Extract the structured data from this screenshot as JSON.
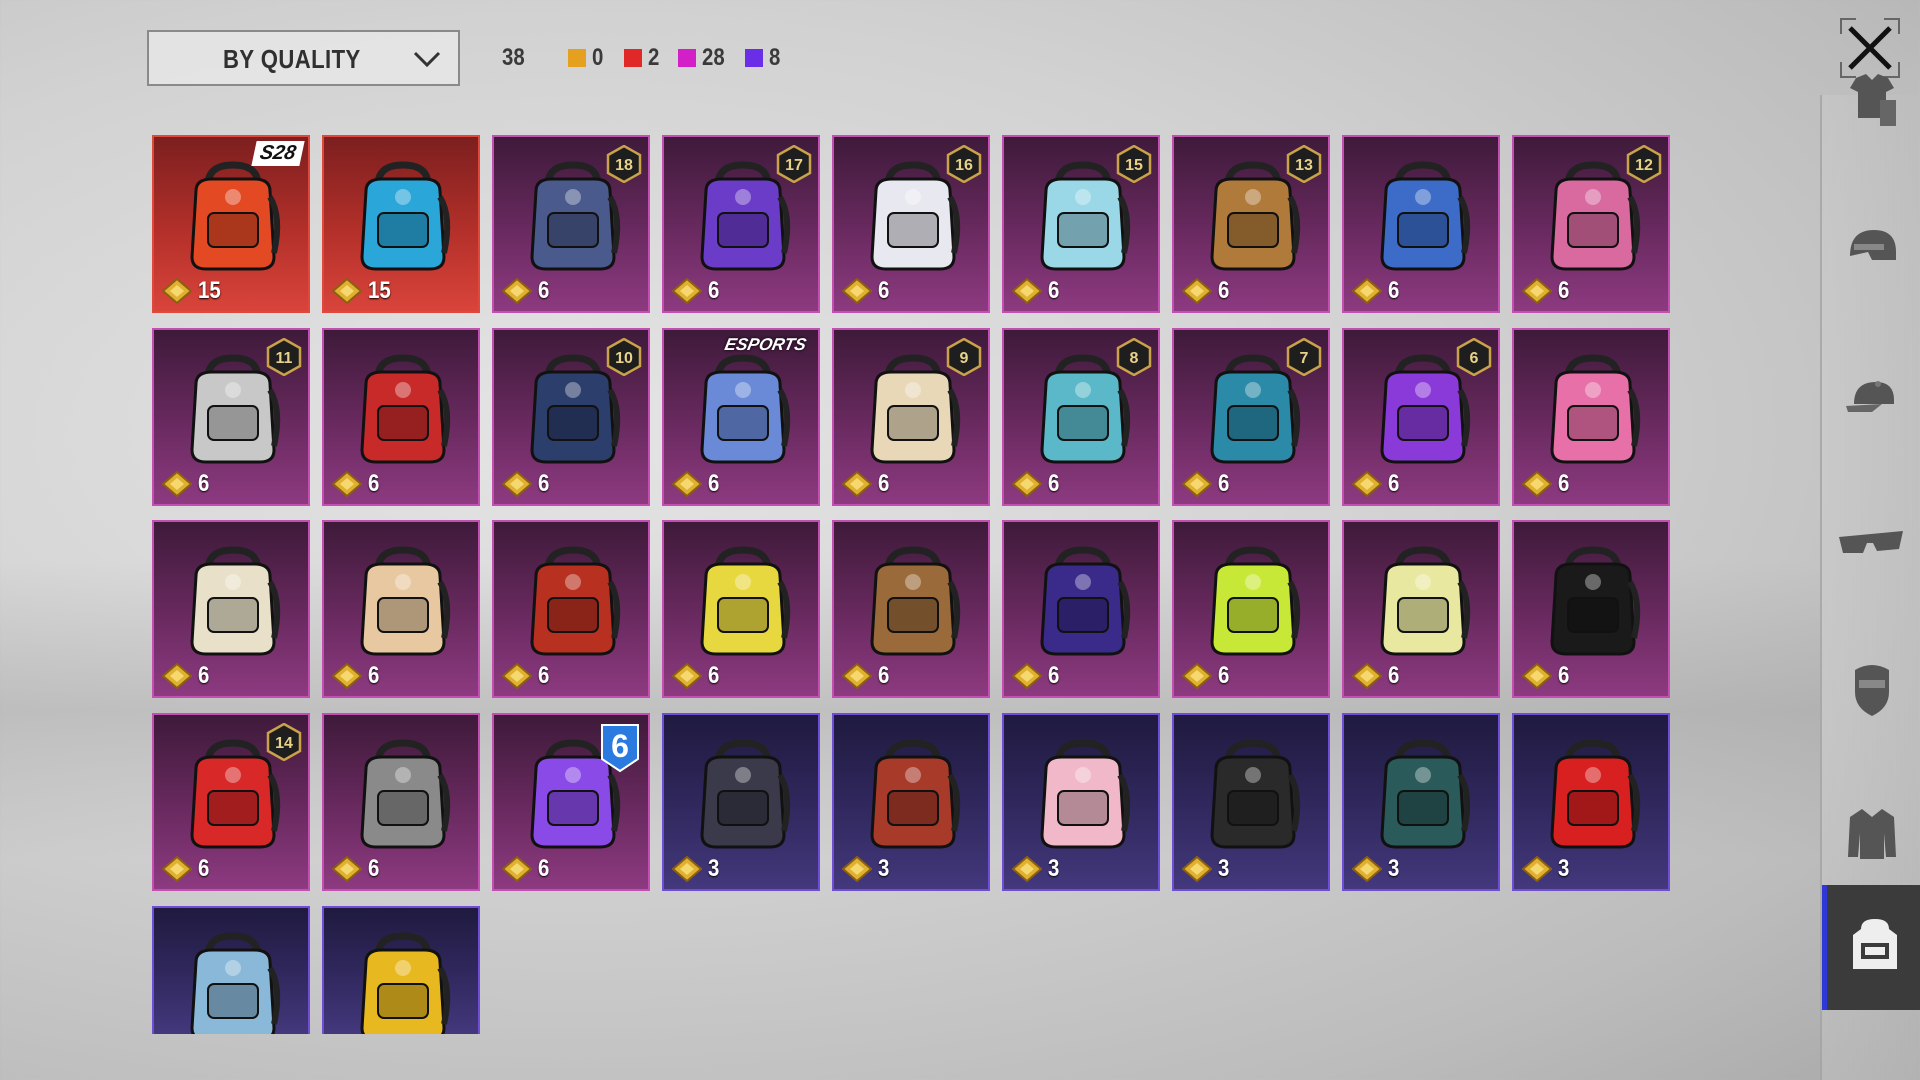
{
  "sort": {
    "label": "BY QUALITY"
  },
  "summary": {
    "total": "38",
    "counts": [
      {
        "color": "#e6a020",
        "value": "0"
      },
      {
        "color": "#e02828",
        "value": "2"
      },
      {
        "color": "#d21fc7",
        "value": "28"
      },
      {
        "color": "#6a2ee6",
        "value": "8"
      }
    ]
  },
  "sidebar": {
    "items": [
      {
        "icon": "outfit-icon",
        "active": false
      },
      {
        "icon": "helmet-icon",
        "active": false
      },
      {
        "icon": "cap-icon",
        "active": false
      },
      {
        "icon": "glasses-icon",
        "active": false
      },
      {
        "icon": "mask-icon",
        "active": false
      },
      {
        "icon": "jacket-icon",
        "active": false
      },
      {
        "icon": "backpack-icon",
        "active": true
      }
    ]
  },
  "items": [
    {
      "quality": "red",
      "price": "15",
      "tag": "S28",
      "color": "#e34a24"
    },
    {
      "quality": "red",
      "price": "15",
      "color": "#2aa6d8"
    },
    {
      "quality": "pink",
      "price": "6",
      "level": "18",
      "color": "#4a5a8c"
    },
    {
      "quality": "pink",
      "price": "6",
      "level": "17",
      "color": "#6b3cc8"
    },
    {
      "quality": "pink",
      "price": "6",
      "level": "16",
      "color": "#e8e8f0"
    },
    {
      "quality": "pink",
      "price": "6",
      "level": "15",
      "color": "#9ad8e8"
    },
    {
      "quality": "pink",
      "price": "6",
      "level": "13",
      "color": "#b07a3a"
    },
    {
      "quality": "pink",
      "price": "6",
      "color": "#3c6cc8"
    },
    {
      "quality": "pink",
      "price": "6",
      "level": "12",
      "color": "#d86aa0"
    },
    {
      "quality": "pink",
      "price": "6",
      "level": "11",
      "color": "#c8c8c8"
    },
    {
      "quality": "pink",
      "price": "6",
      "color": "#c82a2a"
    },
    {
      "quality": "pink",
      "price": "6",
      "level": "10",
      "color": "#2c3e6c"
    },
    {
      "quality": "pink",
      "price": "6",
      "tag": "ESPORTS",
      "color": "#6a8ad8"
    },
    {
      "quality": "pink",
      "price": "6",
      "level": "9",
      "color": "#e8d8b8"
    },
    {
      "quality": "pink",
      "price": "6",
      "level": "8",
      "color": "#5ab8c8"
    },
    {
      "quality": "pink",
      "price": "6",
      "level": "7",
      "color": "#2a8aa8"
    },
    {
      "quality": "pink",
      "price": "6",
      "level": "6",
      "color": "#8a3ad8"
    },
    {
      "quality": "pink",
      "price": "6",
      "color": "#e870a8"
    },
    {
      "quality": "pink",
      "price": "6",
      "color": "#e8e0c8"
    },
    {
      "quality": "pink",
      "price": "6",
      "color": "#e8c8a0"
    },
    {
      "quality": "pink",
      "price": "6",
      "color": "#b83020"
    },
    {
      "quality": "pink",
      "price": "6",
      "color": "#e8d840"
    },
    {
      "quality": "pink",
      "price": "6",
      "color": "#9a6a3a"
    },
    {
      "quality": "pink",
      "price": "6",
      "color": "#3a2a8a"
    },
    {
      "quality": "pink",
      "price": "6",
      "color": "#c8e838"
    },
    {
      "quality": "pink",
      "price": "6",
      "color": "#e8e8a0"
    },
    {
      "quality": "pink",
      "price": "6",
      "color": "#1a1a1a"
    },
    {
      "quality": "pink",
      "price": "6",
      "level": "14",
      "color": "#d82828"
    },
    {
      "quality": "pink",
      "price": "6",
      "color": "#8a8a8a"
    },
    {
      "quality": "pink",
      "price": "6",
      "big": "6",
      "color": "#8a4ae8"
    },
    {
      "quality": "purple",
      "price": "3",
      "color": "#3a3a4a"
    },
    {
      "quality": "purple",
      "price": "3",
      "color": "#a83a2a"
    },
    {
      "quality": "purple",
      "price": "3",
      "color": "#f0b8c8"
    },
    {
      "quality": "purple",
      "price": "3",
      "color": "#2a2a2a"
    },
    {
      "quality": "purple",
      "price": "3",
      "color": "#2a5a5a"
    },
    {
      "quality": "purple",
      "price": "3",
      "color": "#d82020"
    },
    {
      "quality": "purple",
      "color": "#8ab8d8"
    },
    {
      "quality": "purple",
      "color": "#e8b820"
    }
  ]
}
